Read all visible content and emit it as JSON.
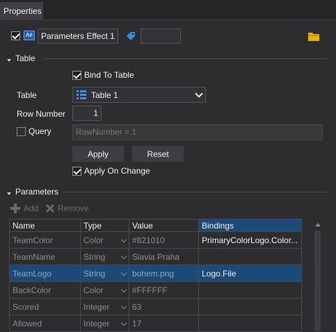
{
  "tab": {
    "label": "Properties"
  },
  "header": {
    "enabled": true,
    "name_value": "Parameters Effect 1",
    "tag_value": ""
  },
  "table_section": {
    "title": "Table",
    "bind_to_table_label": "Bind To Table",
    "table_label": "Table",
    "table_selected": "Table 1",
    "row_number_label": "Row Number",
    "row_number_value": "1",
    "query_label": "Query",
    "query_value": "RowNumber = 1",
    "apply_label": "Apply",
    "reset_label": "Reset",
    "apply_on_change_label": "Apply On Change"
  },
  "parameters_section": {
    "title": "Parameters",
    "add_label": "Add",
    "remove_label": "Remove",
    "columns": [
      "Name",
      "Type",
      "Value",
      "Bindings"
    ],
    "rows": [
      {
        "name": "TeamColor",
        "type": "Color",
        "value": "#821010",
        "binding": "PrimaryColorLogo.Color..."
      },
      {
        "name": "TeamName",
        "type": "String",
        "value": "Slavia Praha",
        "binding": ""
      },
      {
        "name": "TeamLogo",
        "type": "String",
        "value": "bohem.png",
        "binding": "Logo.File"
      },
      {
        "name": "BackColor",
        "type": "Color",
        "value": "#FFFFFF",
        "binding": ""
      },
      {
        "name": "Scored",
        "type": "Integer",
        "value": "63",
        "binding": ""
      },
      {
        "name": "Allowed",
        "type": "Integer",
        "value": "17",
        "binding": ""
      }
    ]
  },
  "colors": {
    "accent": "#1c4a78",
    "folder": "#e8b400",
    "tag": "#2f8fe8"
  }
}
